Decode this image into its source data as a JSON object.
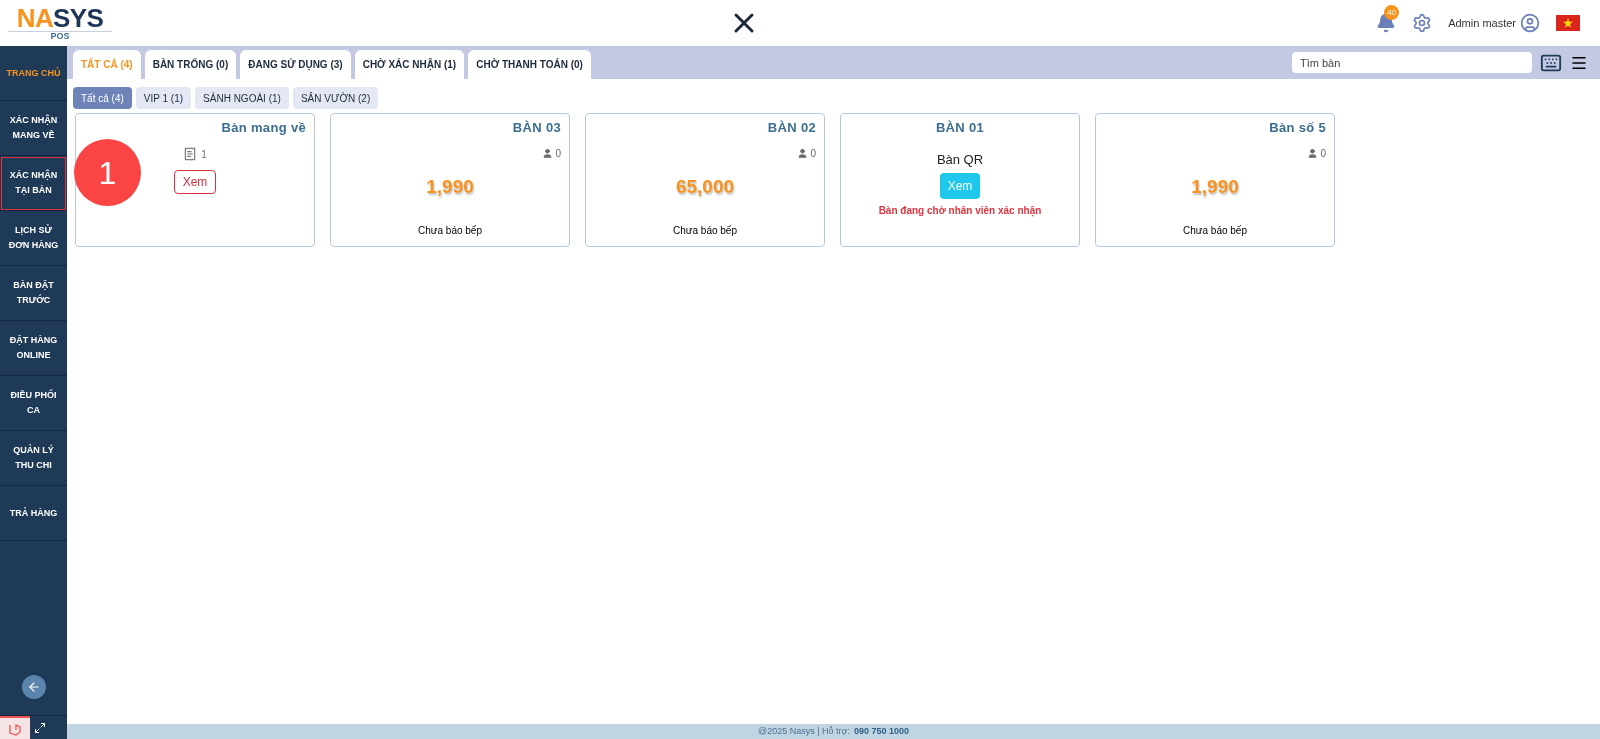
{
  "header": {
    "logo_main": "NASYS",
    "logo_sub": "POS",
    "notification_count": "40",
    "user": "Admin master"
  },
  "sidebar": {
    "items": [
      {
        "label": "TRANG CHỦ",
        "selected": true,
        "highlighted": false
      },
      {
        "label": "XÁC NHẬN MANG VỀ",
        "selected": false,
        "highlighted": false
      },
      {
        "label": "XÁC NHẬN TẠI BÀN",
        "selected": false,
        "highlighted": true
      },
      {
        "label": "LỊCH SỬ ĐƠN HÀNG",
        "selected": false,
        "highlighted": false
      },
      {
        "label": "BÀN ĐẶT TRƯỚC",
        "selected": false,
        "highlighted": false
      },
      {
        "label": "ĐẶT HÀNG ONLINE",
        "selected": false,
        "highlighted": false
      },
      {
        "label": "ĐIỀU PHỐI CA",
        "selected": false,
        "highlighted": false
      },
      {
        "label": "QUẢN LÝ THU CHI",
        "selected": false,
        "highlighted": false
      },
      {
        "label": "TRẢ HÀNG",
        "selected": false,
        "highlighted": false
      }
    ]
  },
  "status_tabs": [
    {
      "label": "TẤT CẢ (4)",
      "selected": true
    },
    {
      "label": "BÀN TRỐNG (0)",
      "selected": false
    },
    {
      "label": "ĐANG SỬ DỤNG (3)",
      "selected": false
    },
    {
      "label": "CHỜ XÁC NHẬN (1)",
      "selected": false
    },
    {
      "label": "CHỜ THANH TOÁN (0)",
      "selected": false
    }
  ],
  "search": {
    "placeholder": "Tìm bàn"
  },
  "area_tabs": [
    {
      "label": "Tất cả (4)",
      "selected": true
    },
    {
      "label": "VIP 1 (1)",
      "selected": false
    },
    {
      "label": "SẢNH NGOÀI (1)",
      "selected": false
    },
    {
      "label": "SÂN VƯỜN (2)",
      "selected": false
    }
  ],
  "tables": [
    {
      "kind": "takeaway",
      "name": "Bàn mang về",
      "count": "1",
      "button": "Xem"
    },
    {
      "kind": "occupied",
      "name": "BÀN 03",
      "guests": "0",
      "amount": "1,990",
      "status": "Chưa báo bếp"
    },
    {
      "kind": "occupied",
      "name": "BÀN 02",
      "guests": "0",
      "amount": "65,000",
      "status": "Chưa báo bếp"
    },
    {
      "kind": "qr",
      "name": "BÀN 01",
      "subtitle": "Bàn QR",
      "button": "Xem",
      "message": "Bàn đang chờ nhân viên xác nhận"
    },
    {
      "kind": "occupied",
      "name": "Bàn số 5",
      "guests": "0",
      "amount": "1,990",
      "status": "Chưa báo bếp"
    }
  ],
  "annotation": "1",
  "footer": {
    "text": "@2025 Nasys | Hỗ trợ:",
    "phone": "090 750 1000"
  }
}
